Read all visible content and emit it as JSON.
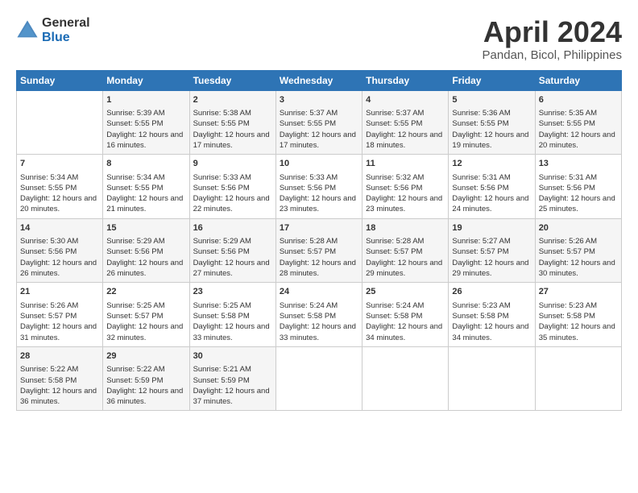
{
  "logo": {
    "line1": "General",
    "line2": "Blue"
  },
  "title": "April 2024",
  "subtitle": "Pandan, Bicol, Philippines",
  "days_header": [
    "Sunday",
    "Monday",
    "Tuesday",
    "Wednesday",
    "Thursday",
    "Friday",
    "Saturday"
  ],
  "weeks": [
    [
      {
        "day": "",
        "sunrise": "",
        "sunset": "",
        "daylight": ""
      },
      {
        "day": "1",
        "sunrise": "Sunrise: 5:39 AM",
        "sunset": "Sunset: 5:55 PM",
        "daylight": "Daylight: 12 hours and 16 minutes."
      },
      {
        "day": "2",
        "sunrise": "Sunrise: 5:38 AM",
        "sunset": "Sunset: 5:55 PM",
        "daylight": "Daylight: 12 hours and 17 minutes."
      },
      {
        "day": "3",
        "sunrise": "Sunrise: 5:37 AM",
        "sunset": "Sunset: 5:55 PM",
        "daylight": "Daylight: 12 hours and 17 minutes."
      },
      {
        "day": "4",
        "sunrise": "Sunrise: 5:37 AM",
        "sunset": "Sunset: 5:55 PM",
        "daylight": "Daylight: 12 hours and 18 minutes."
      },
      {
        "day": "5",
        "sunrise": "Sunrise: 5:36 AM",
        "sunset": "Sunset: 5:55 PM",
        "daylight": "Daylight: 12 hours and 19 minutes."
      },
      {
        "day": "6",
        "sunrise": "Sunrise: 5:35 AM",
        "sunset": "Sunset: 5:55 PM",
        "daylight": "Daylight: 12 hours and 20 minutes."
      }
    ],
    [
      {
        "day": "7",
        "sunrise": "Sunrise: 5:34 AM",
        "sunset": "Sunset: 5:55 PM",
        "daylight": "Daylight: 12 hours and 20 minutes."
      },
      {
        "day": "8",
        "sunrise": "Sunrise: 5:34 AM",
        "sunset": "Sunset: 5:55 PM",
        "daylight": "Daylight: 12 hours and 21 minutes."
      },
      {
        "day": "9",
        "sunrise": "Sunrise: 5:33 AM",
        "sunset": "Sunset: 5:56 PM",
        "daylight": "Daylight: 12 hours and 22 minutes."
      },
      {
        "day": "10",
        "sunrise": "Sunrise: 5:33 AM",
        "sunset": "Sunset: 5:56 PM",
        "daylight": "Daylight: 12 hours and 23 minutes."
      },
      {
        "day": "11",
        "sunrise": "Sunrise: 5:32 AM",
        "sunset": "Sunset: 5:56 PM",
        "daylight": "Daylight: 12 hours and 23 minutes."
      },
      {
        "day": "12",
        "sunrise": "Sunrise: 5:31 AM",
        "sunset": "Sunset: 5:56 PM",
        "daylight": "Daylight: 12 hours and 24 minutes."
      },
      {
        "day": "13",
        "sunrise": "Sunrise: 5:31 AM",
        "sunset": "Sunset: 5:56 PM",
        "daylight": "Daylight: 12 hours and 25 minutes."
      }
    ],
    [
      {
        "day": "14",
        "sunrise": "Sunrise: 5:30 AM",
        "sunset": "Sunset: 5:56 PM",
        "daylight": "Daylight: 12 hours and 26 minutes."
      },
      {
        "day": "15",
        "sunrise": "Sunrise: 5:29 AM",
        "sunset": "Sunset: 5:56 PM",
        "daylight": "Daylight: 12 hours and 26 minutes."
      },
      {
        "day": "16",
        "sunrise": "Sunrise: 5:29 AM",
        "sunset": "Sunset: 5:56 PM",
        "daylight": "Daylight: 12 hours and 27 minutes."
      },
      {
        "day": "17",
        "sunrise": "Sunrise: 5:28 AM",
        "sunset": "Sunset: 5:57 PM",
        "daylight": "Daylight: 12 hours and 28 minutes."
      },
      {
        "day": "18",
        "sunrise": "Sunrise: 5:28 AM",
        "sunset": "Sunset: 5:57 PM",
        "daylight": "Daylight: 12 hours and 29 minutes."
      },
      {
        "day": "19",
        "sunrise": "Sunrise: 5:27 AM",
        "sunset": "Sunset: 5:57 PM",
        "daylight": "Daylight: 12 hours and 29 minutes."
      },
      {
        "day": "20",
        "sunrise": "Sunrise: 5:26 AM",
        "sunset": "Sunset: 5:57 PM",
        "daylight": "Daylight: 12 hours and 30 minutes."
      }
    ],
    [
      {
        "day": "21",
        "sunrise": "Sunrise: 5:26 AM",
        "sunset": "Sunset: 5:57 PM",
        "daylight": "Daylight: 12 hours and 31 minutes."
      },
      {
        "day": "22",
        "sunrise": "Sunrise: 5:25 AM",
        "sunset": "Sunset: 5:57 PM",
        "daylight": "Daylight: 12 hours and 32 minutes."
      },
      {
        "day": "23",
        "sunrise": "Sunrise: 5:25 AM",
        "sunset": "Sunset: 5:58 PM",
        "daylight": "Daylight: 12 hours and 33 minutes."
      },
      {
        "day": "24",
        "sunrise": "Sunrise: 5:24 AM",
        "sunset": "Sunset: 5:58 PM",
        "daylight": "Daylight: 12 hours and 33 minutes."
      },
      {
        "day": "25",
        "sunrise": "Sunrise: 5:24 AM",
        "sunset": "Sunset: 5:58 PM",
        "daylight": "Daylight: 12 hours and 34 minutes."
      },
      {
        "day": "26",
        "sunrise": "Sunrise: 5:23 AM",
        "sunset": "Sunset: 5:58 PM",
        "daylight": "Daylight: 12 hours and 34 minutes."
      },
      {
        "day": "27",
        "sunrise": "Sunrise: 5:23 AM",
        "sunset": "Sunset: 5:58 PM",
        "daylight": "Daylight: 12 hours and 35 minutes."
      }
    ],
    [
      {
        "day": "28",
        "sunrise": "Sunrise: 5:22 AM",
        "sunset": "Sunset: 5:58 PM",
        "daylight": "Daylight: 12 hours and 36 minutes."
      },
      {
        "day": "29",
        "sunrise": "Sunrise: 5:22 AM",
        "sunset": "Sunset: 5:59 PM",
        "daylight": "Daylight: 12 hours and 36 minutes."
      },
      {
        "day": "30",
        "sunrise": "Sunrise: 5:21 AM",
        "sunset": "Sunset: 5:59 PM",
        "daylight": "Daylight: 12 hours and 37 minutes."
      },
      {
        "day": "",
        "sunrise": "",
        "sunset": "",
        "daylight": ""
      },
      {
        "day": "",
        "sunrise": "",
        "sunset": "",
        "daylight": ""
      },
      {
        "day": "",
        "sunrise": "",
        "sunset": "",
        "daylight": ""
      },
      {
        "day": "",
        "sunrise": "",
        "sunset": "",
        "daylight": ""
      }
    ]
  ]
}
